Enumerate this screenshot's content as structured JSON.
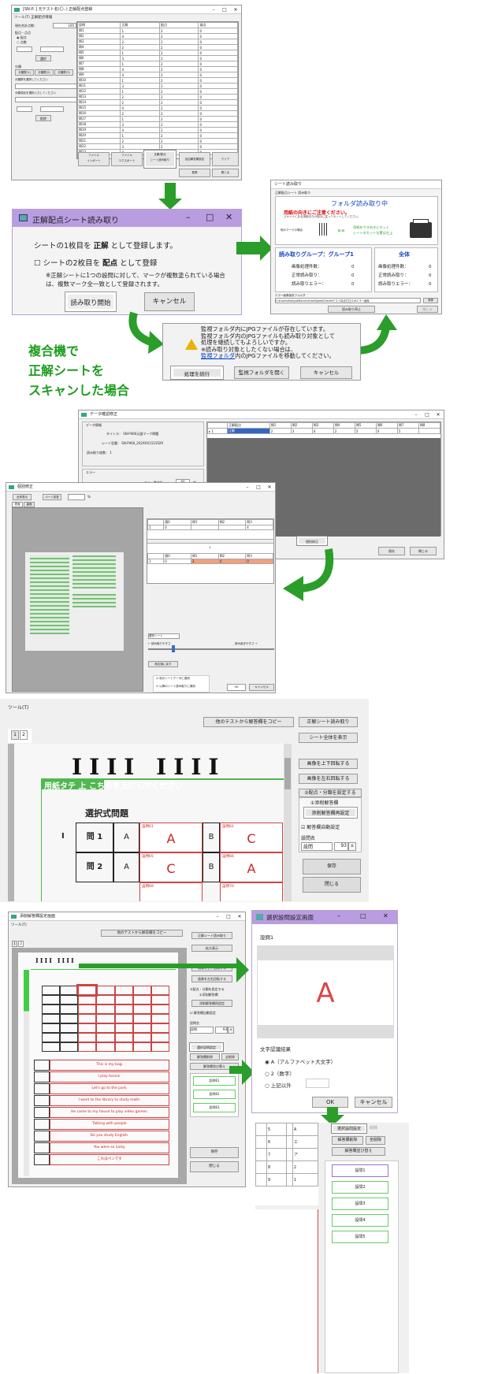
{
  "s1": {
    "title": "[SN-P..] 元テスト名(〇..) 正解配点登録",
    "menu": "ツール(T)  正解配点情報",
    "labels": [
      "現在合計点数：",
      "100",
      "配点・点点",
      "配点",
      "点数",
      "部分点"
    ],
    "button_select": "選択",
    "kaisha": "分類",
    "tabs": [
      "分類群(1)",
      "分類群(2)",
      "分類群(3)"
    ],
    "kaisha_label": "分類群を選択してください",
    "genre_label": "分類項目を選択入力してください",
    "del": "削除",
    "grid_headers": [
      "設問",
      "正解",
      "配点",
      "減点"
    ],
    "grid_rows": [
      [
        "問1",
        "1",
        "2",
        "0"
      ],
      [
        "問2",
        "4",
        "2",
        "0"
      ],
      [
        "問3",
        "2",
        "2",
        "0"
      ],
      [
        "問4",
        "2",
        "2",
        "0"
      ],
      [
        "問5",
        "1",
        "2",
        "0"
      ],
      [
        "問6",
        "3",
        "2",
        "0"
      ],
      [
        "問7",
        "1",
        "2",
        "0"
      ],
      [
        "問8",
        "4",
        "2",
        "0"
      ],
      [
        "問9",
        "4",
        "2",
        "0"
      ],
      [
        "問10",
        "1",
        "2",
        "0"
      ],
      [
        "問11",
        "3",
        "2",
        "0"
      ],
      [
        "問12",
        "1",
        "2",
        "0"
      ],
      [
        "問13",
        "2",
        "2",
        "0"
      ],
      [
        "問14",
        "2",
        "2",
        "0"
      ],
      [
        "問15",
        "4",
        "2",
        "0"
      ],
      [
        "問16",
        "2",
        "2",
        "0"
      ],
      [
        "問17",
        "1",
        "2",
        "0"
      ],
      [
        "問18",
        "3",
        "2",
        "0"
      ],
      [
        "問19",
        "4",
        "2",
        "0"
      ],
      [
        "問20",
        "1",
        "2",
        "0"
      ],
      [
        "問21",
        "2",
        "2",
        "0"
      ],
      [
        "問22",
        "3",
        "2",
        "0"
      ],
      [
        "問23",
        "4",
        "2",
        "0"
      ],
      [
        "問24",
        "1",
        "2",
        "0"
      ],
      [
        "問25",
        "2",
        "2",
        "0"
      ],
      [
        "問26",
        "3",
        "2",
        "0"
      ],
      [
        "問27",
        "1",
        "2",
        "0"
      ],
      [
        "問28",
        "2",
        "2",
        "0"
      ],
      [
        "問29",
        "1",
        "2",
        "0"
      ],
      [
        "問30",
        "4",
        "2",
        "0"
      ]
    ],
    "bottom_buttons": [
      "ファイル\nインポート",
      "ファイル\nエクスポート",
      "正解/配点\nシート読み取り",
      "自由解答欄設定",
      "クリア",
      "登録",
      "閉じる"
    ]
  },
  "s2": {
    "title": "正解配点シート読み取り",
    "line1": "シートの1枚目を 正解 として登録します。",
    "line1_a": "シートの1枚目を ",
    "line1_b": "正解",
    "line1_c": " として登録します。",
    "check": "シートの2枚目を 配点 として登録",
    "check_a": "シートの2枚目を ",
    "check_b": "配点",
    "check_c": " として登録",
    "note": "※正解シートに1つの設問に対して、マークが複数塗られている場合は、複数マーク全一致として登録されます。",
    "ok": "読み取り開始",
    "cancel": "キャンセル"
  },
  "s3": {
    "title": "シート読み取り",
    "subtitle": "正解配点シート 読み取り",
    "heading": "フォルダ読み取り中",
    "warn1": "用紙の向きにご注意ください。",
    "warn2": "スキャナにある用紙向きの指示に従ってセットしてください。",
    "left_label": "他のマークの場合",
    "green1": "用紙をウラ向きにセット",
    "green2": "シートのカット位置は左上",
    "group_title": "読み取りグループ：グループ1",
    "total_title": "全体",
    "rows": [
      "画像処理件数：",
      "正常読み取り：",
      "読み取りエラー："
    ],
    "vals": [
      "0",
      "0",
      "0"
    ],
    "folder_label": "エラー画像保存フォルダ",
    "folder_path": "C:¥Users¥hokyo¥Documents¥SpeedCheck¥テスト採点〇〇(1)¥エラー画像",
    "stop": "読み取り停止",
    "close": "閉じる",
    "ref": "参照"
  },
  "s4": {
    "line1": "監視フォルダ内にJPGファイルが存在しています。",
    "line2": "監視フォルダ内のJPGファイルも読み取り対象として",
    "line3": "処理を継続してもよろしいですか。",
    "line4": "※読み取り対象としたくない場合は、",
    "line5a": "監視フォルダ",
    "line5b": "内のJPGファイルを移動してください。",
    "b1": "処理を続行",
    "b2": "監視フォルダを開く",
    "b3": "キャンセル"
  },
  "caption": {
    "l1": "複合機で",
    "l2": "正解シートを",
    "l3": "スキャンした場合"
  },
  "s5": {
    "title": "データ確認修正",
    "grp1": "データ情報",
    "title_l": "タイトル：",
    "title_v": "SN-P460元図マーク問題",
    "sheet_l": "シート型番：",
    "sheet_v": "SN-P460_202XXX1515929",
    "count_l": "読み取り枚数：",
    "count_v": "1",
    "grp2": "エラー",
    "err_l": "エラー数合計",
    "err_v": "60",
    "err_u": "件",
    "tbl_h": [
      "状態",
      "エラー種類"
    ],
    "tbl_r": [
      [
        "正",
        "文字エラー"
      ],
      [
        "B",
        "マルチマークエラー"
      ]
    ],
    "grid_h": [
      "正解配点",
      "問1",
      "問2",
      "問3",
      "問4",
      "問5",
      "問6",
      "問7",
      "問8"
    ],
    "grid_r": [
      "正解",
      "2",
      "3",
      "4",
      "2",
      "5",
      "4",
      "5"
    ],
    "check_btn": "個別修正",
    "save": "保存",
    "close": "閉じる"
  },
  "s6": {
    "title": "個別修正",
    "b1": "全体表示",
    "b2": "ページ変更",
    "zoom": "%",
    "tabs": [
      "表面",
      "裏面"
    ],
    "h": [
      "",
      "値0",
      "問1",
      "問2",
      "問3"
    ],
    "r1": [
      "1",
      "0",
      "",
      "",
      "4"
    ],
    "r2": [
      "1",
      "0",
      "3",
      "4",
      "0"
    ],
    "combo": "選択シート",
    "slider_l": "← 読み取りやすさ",
    "slider_r": "読み過ぎやすさ →",
    "reset": "既定値に戻す",
    "chk1": "他のシートデータに適用",
    "chk2": "以降のシート読み取りに適用",
    "ok": "OK",
    "cancel": "キャンセル"
  },
  "s7": {
    "menu": "ツール(T)",
    "copy": "他のテストから解答欄をコピー",
    "pages": [
      "1",
      "2"
    ],
    "r1": "正解シート読み取り",
    "r2": "シート全体を表示",
    "r3": "画像を上下回転する",
    "r4": "画像を左右回転する",
    "r5": "②配点・分類を設定する",
    "r5b": "①添削解答欄",
    "r6": "添削解答欄再設定",
    "r7": "解答欄自動設定",
    "r8": "設問名",
    "r8v": "設問",
    "r8n": "93",
    "save": "保存",
    "close": "閉じる",
    "banner": "用紙タテ 上 こちらを上にしてください",
    "section": "選択式問題",
    "q1": "問 1",
    "q2": "問 2",
    "A": "A",
    "B": "B",
    "ans1": "A",
    "ans2": "C",
    "ans3": "C",
    "ans4": "A",
    "lab61": "設問61",
    "lab62": "設問62",
    "lab65": "設問65",
    "lab66": "設問66",
    "lab69": "設問69",
    "lab70": "設問70",
    "roman": "I",
    "marks": "ⅠⅠⅠⅠ ⅠⅠⅠⅠ"
  },
  "s8": {
    "title": "添削解答欄設定画面",
    "menu": "ツール(T)",
    "copy": "他のテストから解答欄をコピー",
    "r1": "正解シート読み取り",
    "r2": "拡大表示",
    "r3": "画像を上下回転する",
    "r4": "画像を左右回転する",
    "r5": "②配点・分類を設定する",
    "r5b": "①添削解答欄",
    "r6": "添削解答欄再設定",
    "r7": "解答欄自動設定",
    "r8": "設問名",
    "r8v": "設問",
    "r8n": "93",
    "sel": "選択設問設定",
    "del": "解答欄削除",
    "all": "全削除",
    "sort": "解答欄並び替え",
    "items": [
      "設問61",
      "設問62",
      "設問63"
    ],
    "save": "保存",
    "close": "閉じる",
    "answers": [
      "This is my bag.",
      "I play tennis.",
      "Let's go to the park.",
      "I went to the library to study math.",
      "He came to my house to play video games.",
      "Talking with people",
      "Do you study English.",
      "You were so lucky.",
      "これはペンです"
    ]
  },
  "s9": {
    "title": "選択設問設定画面",
    "q": "設問1",
    "big": "A",
    "group": "文字認識結果",
    "o1": "A（アルファベット大文字）",
    "o2": "2（数字）",
    "o3": "上記以外",
    "ok": "OK",
    "cancel": "キャンセル"
  },
  "s10": {
    "sel": "選択設問設定",
    "del2": "削除",
    "del": "解答欄削除",
    "all": "全削除",
    "sort": "解答欄並び替え",
    "items": [
      "設問1",
      "設問2",
      "設問3",
      "設問4",
      "設問5"
    ],
    "left": [
      "A",
      "エ",
      "ア",
      "2",
      "1"
    ],
    "rows": [
      "5",
      "6",
      "7",
      "8",
      "9"
    ]
  }
}
